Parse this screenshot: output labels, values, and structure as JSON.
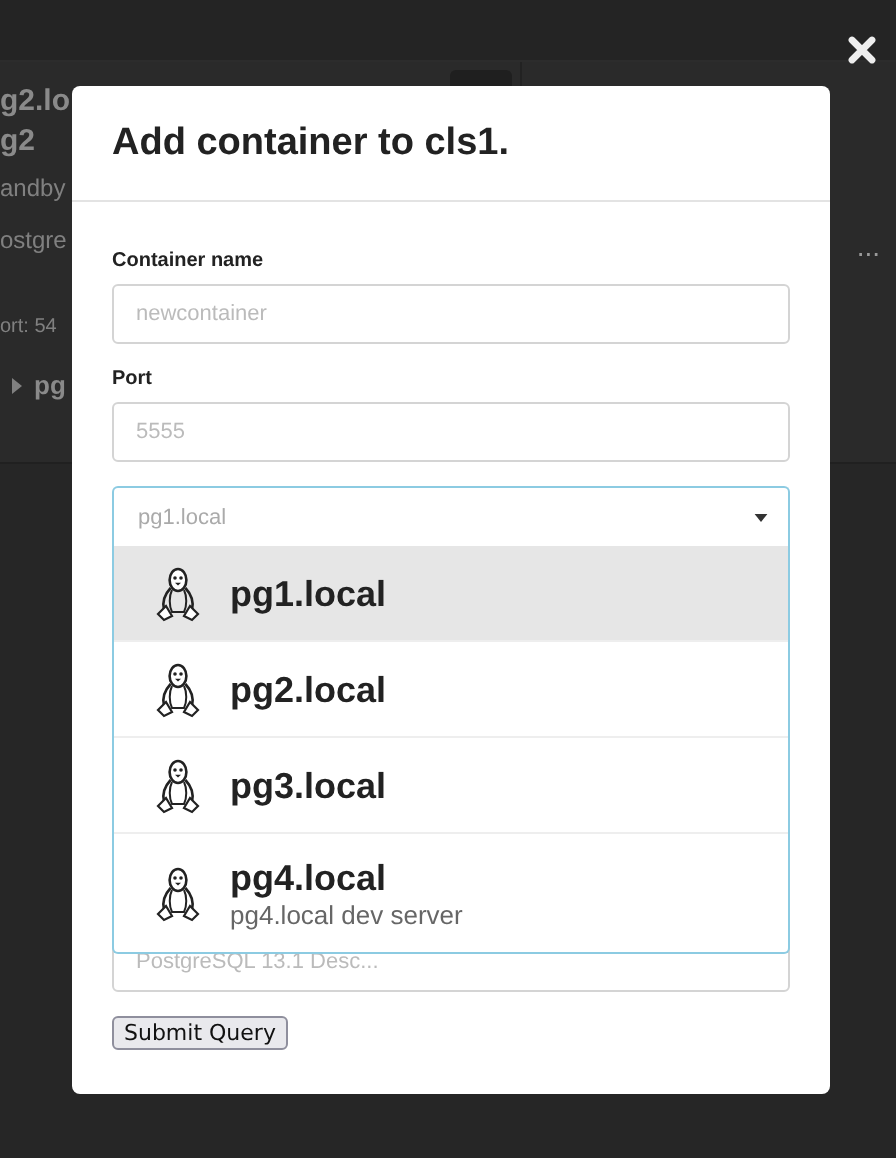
{
  "background": {
    "lines": [
      {
        "kind": "heading",
        "text": "g2.lo"
      },
      {
        "kind": "heading",
        "text": "g2"
      },
      {
        "kind": "status",
        "text": "andby"
      },
      {
        "kind": "body",
        "text": "ostgre"
      },
      {
        "kind": "port",
        "text": "ort: 54"
      },
      {
        "kind": "tree",
        "text": "pg"
      }
    ],
    "right_text": "..."
  },
  "modal": {
    "title": "Add container to cls1.",
    "fields": [
      {
        "label": "Container name",
        "placeholder": "newcontainer"
      },
      {
        "label": "Port",
        "placeholder": "5555"
      }
    ],
    "select": {
      "placeholder": "pg1.local",
      "options": [
        {
          "name": "pg1.local",
          "selected": true
        },
        {
          "name": "pg2.local",
          "selected": false
        },
        {
          "name": "pg3.local",
          "selected": false
        },
        {
          "name": "pg4.local",
          "description": "pg4.local dev server",
          "selected": false
        }
      ]
    },
    "description_field": {
      "placeholder": "PostgreSQL 13.1 Desc..."
    },
    "submit": "Submit Query"
  }
}
